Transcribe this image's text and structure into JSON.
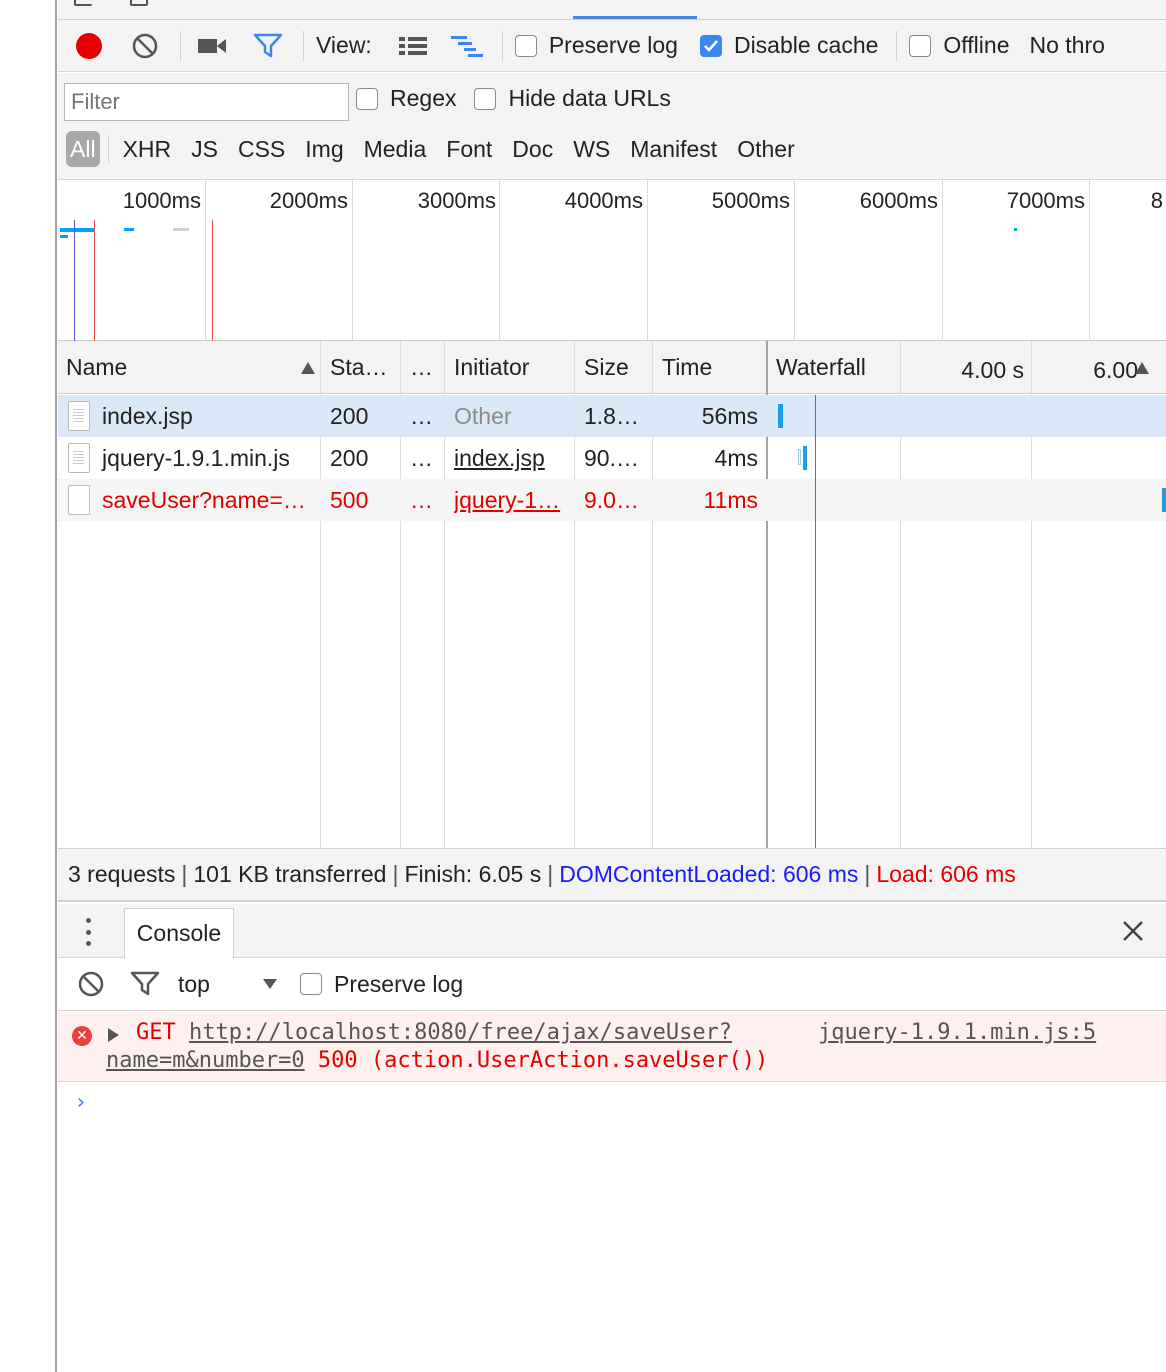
{
  "toolbar": {
    "view_label": "View:",
    "preserve_log": "Preserve log",
    "preserve_log_checked": false,
    "disable_cache": "Disable cache",
    "disable_cache_checked": true,
    "offline": "Offline",
    "offline_checked": false,
    "throttle": "No thro"
  },
  "filter": {
    "placeholder": "Filter",
    "regex": "Regex",
    "hide_data_urls": "Hide data URLs",
    "types": [
      "All",
      "XHR",
      "JS",
      "CSS",
      "Img",
      "Media",
      "Font",
      "Doc",
      "WS",
      "Manifest",
      "Other"
    ],
    "active_type": "All"
  },
  "overview": {
    "ticks": [
      "1000ms",
      "2000ms",
      "3000ms",
      "4000ms",
      "5000ms",
      "6000ms",
      "7000ms",
      "8"
    ]
  },
  "table": {
    "headers": {
      "name": "Name",
      "status": "Sta…",
      "type": "…",
      "initiator": "Initiator",
      "size": "Size",
      "time": "Time",
      "waterfall": "Waterfall",
      "wf_tick1": "4.00 s",
      "wf_tick2": "6.00"
    },
    "rows": [
      {
        "name": "index.jsp",
        "status": "200",
        "type": "…",
        "initiator": "Other",
        "size": "1.8…",
        "time": "56ms",
        "error": false
      },
      {
        "name": "jquery-1.9.1.min.js",
        "status": "200",
        "type": "…",
        "initiator": "index.jsp",
        "size": "90.…",
        "time": "4ms",
        "error": false
      },
      {
        "name": "saveUser?name=…",
        "status": "500",
        "type": "…",
        "initiator": "jquery-1…",
        "size": "9.0…",
        "time": "11ms",
        "error": true
      }
    ]
  },
  "summary": {
    "requests": "3 requests",
    "transferred": "101 KB transferred",
    "finish": "Finish: 6.05 s",
    "dom_loaded": "DOMContentLoaded: 606 ms",
    "load": "Load: 606 ms",
    "sep": "|"
  },
  "drawer": {
    "tab": "Console",
    "context": "top",
    "preserve_log": "Preserve log"
  },
  "console": {
    "method": "GET",
    "url_part1": "http://localhost:8080/free/ajax/saveUser?",
    "url_part2": "name=m&number=0",
    "rest": " 500 (action.UserAction.saveUser())",
    "source": "jquery-1.9.1.min.js:5",
    "prompt": "›"
  },
  "colors": {
    "record": "#e40000",
    "accent": "#3b86f4",
    "error": "#e40000",
    "dom_loaded": "#1a1aff"
  }
}
